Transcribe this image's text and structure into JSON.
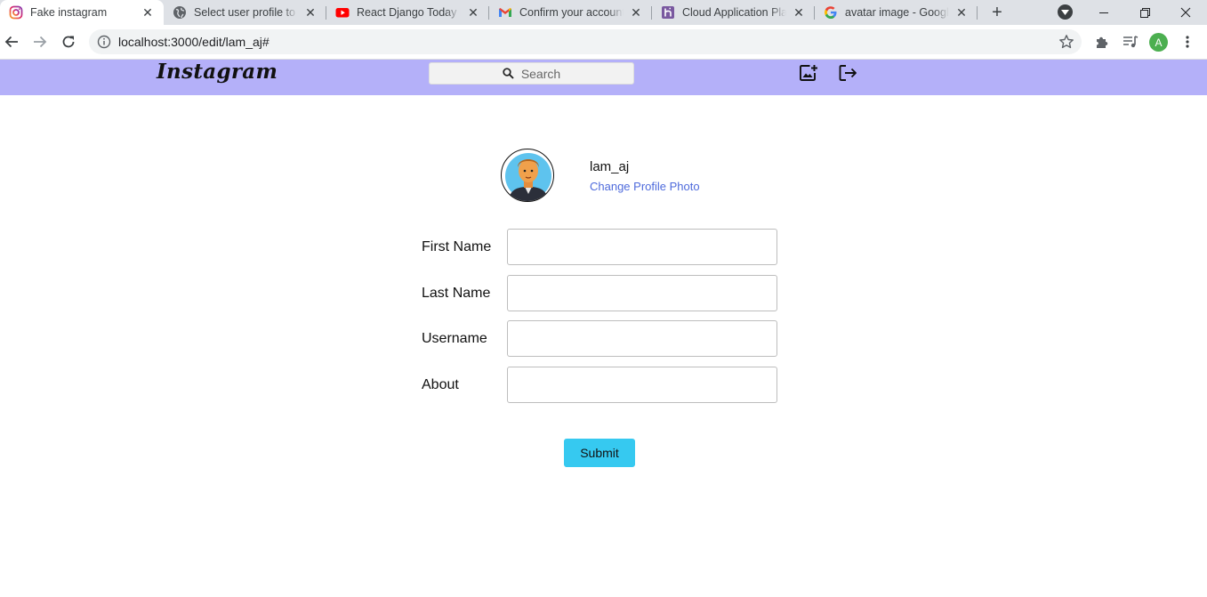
{
  "browser": {
    "tabs": [
      {
        "title": "Fake instagram",
        "favicon": "instagram-icon",
        "active": true
      },
      {
        "title": "Select user profile to d",
        "favicon": "globe-icon",
        "active": false
      },
      {
        "title": "React Django Today Pl",
        "favicon": "youtube-icon",
        "active": false
      },
      {
        "title": "Confirm your account",
        "favicon": "gmail-icon",
        "active": false
      },
      {
        "title": "Cloud Application Platf",
        "favicon": "heroku-icon",
        "active": false
      },
      {
        "title": "avatar image - Google",
        "favicon": "google-icon",
        "active": false
      }
    ],
    "url": "localhost:3000/edit/lam_aj#",
    "profile_initial": "A"
  },
  "app": {
    "logo": "Instagram",
    "search_placeholder": "Search",
    "brand_color": "#b4b0f9"
  },
  "profile": {
    "username": "lam_aj",
    "change_photo": "Change Profile Photo"
  },
  "form": {
    "fields": [
      {
        "label": "First Name",
        "value": ""
      },
      {
        "label": "Last Name",
        "value": ""
      },
      {
        "label": "Username",
        "value": ""
      },
      {
        "label": "About",
        "value": ""
      }
    ],
    "submit_label": "Submit",
    "submit_color": "#36c9f0"
  }
}
